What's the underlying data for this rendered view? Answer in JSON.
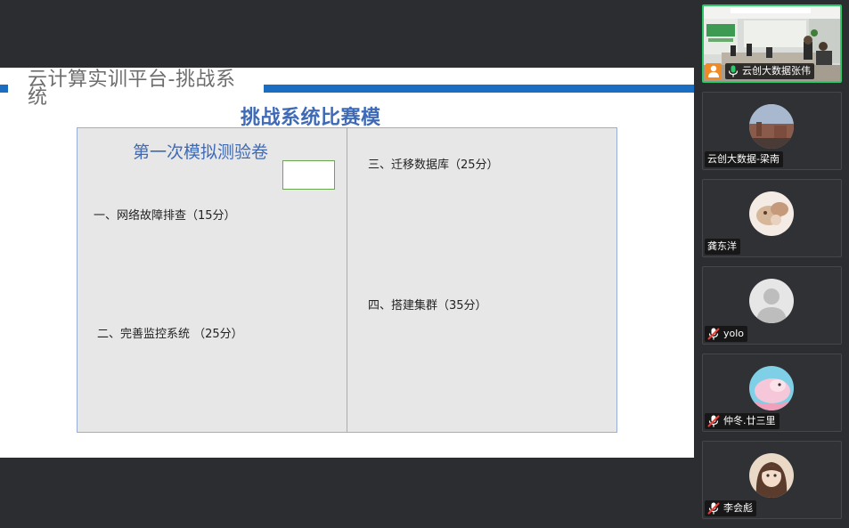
{
  "slide": {
    "header": "云计算实训平台-挑战系统",
    "subtitle": "挑战系统比赛模",
    "table_title": "第一次模拟测验卷",
    "items": [
      "一、网络故障排查（15分）",
      "二、完善监控系统 （25分）",
      "三、迁移数据库（25分）",
      "四、搭建集群（35分）"
    ]
  },
  "participants": [
    {
      "name": "云创大数据张伟",
      "mic": "on",
      "video": true,
      "host": true
    },
    {
      "name": "云创大数据-梁南",
      "mic": "none",
      "video": false
    },
    {
      "name": "龚东洋",
      "mic": "none",
      "video": false
    },
    {
      "name": "yolo",
      "mic": "muted",
      "video": false
    },
    {
      "name": "仲冬.廿三里",
      "mic": "muted",
      "video": false
    },
    {
      "name": "李会彪",
      "mic": "muted",
      "video": false
    }
  ],
  "colors": {
    "accent_blue": "#1b6dc1",
    "title_blue": "#3e6ab7",
    "active_speaker": "#2bc96a",
    "muted_red": "#e0433a",
    "host_orange": "#f08a24"
  }
}
